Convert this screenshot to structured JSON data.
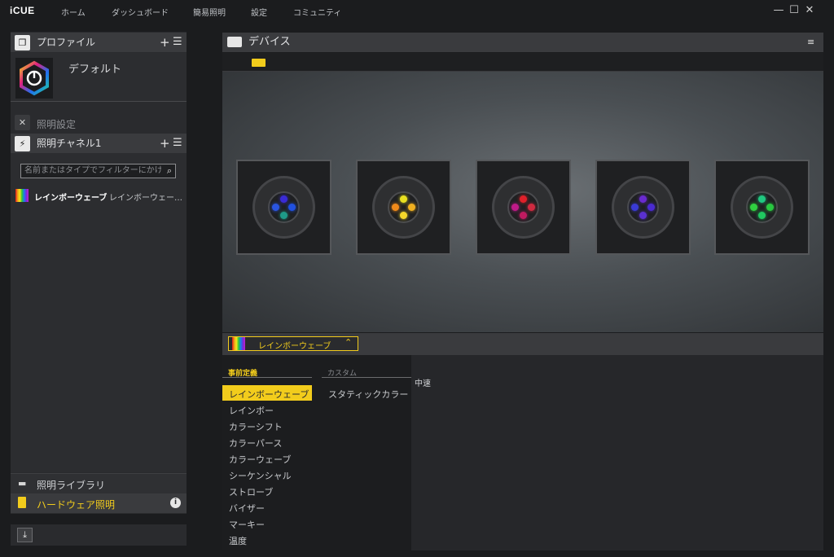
{
  "app": {
    "logo": "iCUE"
  },
  "nav": [
    "ホーム",
    "ダッシュボード",
    "簡易照明",
    "設定",
    "コミュニティ"
  ],
  "window": {
    "minimize": "—",
    "maximize": "☐",
    "close": "✕"
  },
  "profile": {
    "title": "プロファイル",
    "name": "デフォルト"
  },
  "lighting_settings": {
    "title": "照明設定"
  },
  "channel": {
    "title": "照明チャネル1",
    "search_placeholder": "名前またはタイプでフィルターにかける",
    "effect_name": "レインボーウェーブ",
    "effect_type": "レインボーウェー…"
  },
  "library": {
    "title": "照明ライブラリ"
  },
  "hardware": {
    "title": "ハードウェア照明"
  },
  "devices": {
    "title": "デバイス"
  },
  "selected_effect": "レインボーウェーブ",
  "tabs": {
    "predefined": "事前定義",
    "custom": "カスタム"
  },
  "speed": "中速",
  "predefined_effects": [
    "レインボーウェーブ",
    "レインボー",
    "カラーシフト",
    "カラーパース",
    "カラーウェーブ",
    "シーケンシャル",
    "ストローブ",
    "バイザー",
    "マーキー",
    "温度"
  ],
  "custom_effects": [
    "スタティックカラー"
  ],
  "colors": {
    "accent": "#f2cc1c"
  },
  "fans": [
    {
      "leds": [
        "#3a2bd6",
        "#2050e0",
        "#2a55e0",
        "#1e9a88"
      ]
    },
    {
      "leds": [
        "#e8e020",
        "#f0b020",
        "#f08a1a",
        "#f5d82a"
      ]
    },
    {
      "leds": [
        "#e0202a",
        "#d02a40",
        "#c01a88",
        "#c01a60"
      ]
    },
    {
      "leds": [
        "#6a2ad0",
        "#4a2ad0",
        "#3a3ad6",
        "#5a30d0"
      ]
    },
    {
      "leds": [
        "#20c880",
        "#28c840",
        "#30d040",
        "#20c860"
      ]
    }
  ]
}
